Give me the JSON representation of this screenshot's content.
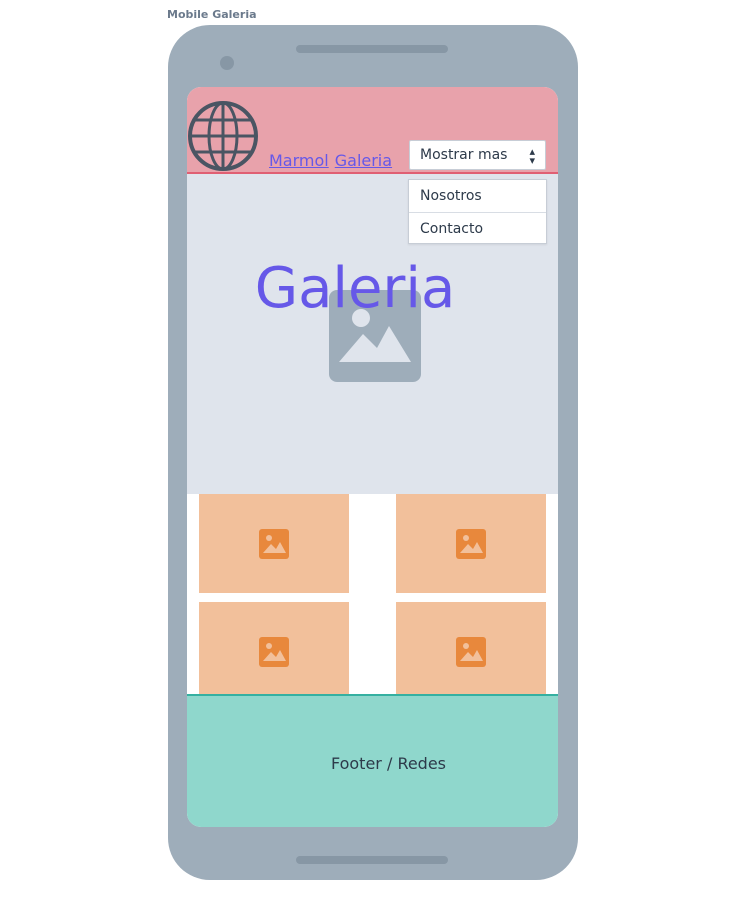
{
  "frame_label": "Mobile Galeria",
  "header": {
    "brand_word_1": "Marmol",
    "brand_word_2": "Galeria",
    "logo_icon": "globe-icon",
    "select": {
      "selected": "Mostrar mas",
      "caret_icon": "up-down-caret-icon"
    }
  },
  "dropdown": {
    "items": [
      {
        "label": "Nosotros"
      },
      {
        "label": "Contacto"
      }
    ]
  },
  "hero": {
    "title": "Galeria",
    "image_icon": "image-placeholder-icon"
  },
  "gallery": {
    "tiles": [
      {
        "icon": "image-icon"
      },
      {
        "icon": "image-icon"
      },
      {
        "icon": "image-icon"
      },
      {
        "icon": "image-icon"
      }
    ]
  },
  "footer": {
    "text": "Footer / Redes"
  },
  "colors": {
    "header_bg": "#e8a2ab",
    "brand_link": "#6658e8",
    "hero_bg": "#dfe4ec",
    "tile_bg": "#f2c09b",
    "tile_icon": "#e8883c",
    "footer_bg": "#8fd7cc",
    "device": "#9eadba"
  }
}
